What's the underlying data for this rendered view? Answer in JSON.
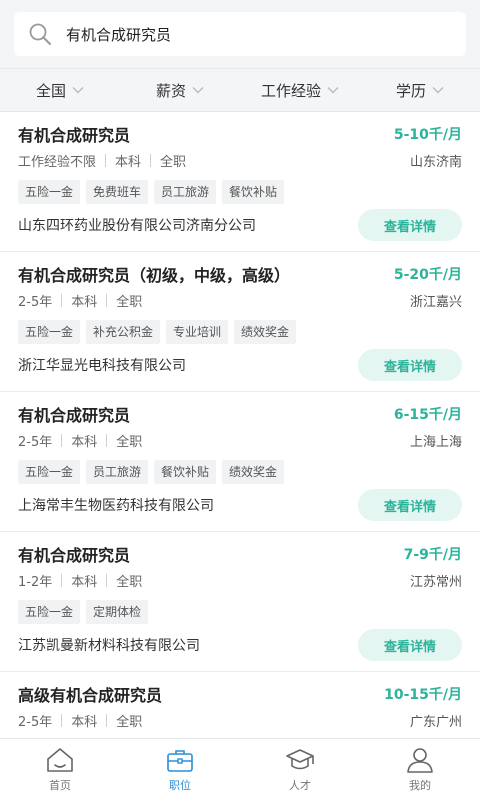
{
  "search": {
    "value": "有机合成研究员"
  },
  "filters": [
    {
      "label": "全国"
    },
    {
      "label": "薪资"
    },
    {
      "label": "工作经验"
    },
    {
      "label": "学历"
    }
  ],
  "jobs": [
    {
      "title": "有机合成研究员",
      "salary": "5-10千/月",
      "experience": "工作经验不限",
      "education": "本科",
      "type": "全职",
      "location": "山东济南",
      "tags": [
        "五险一金",
        "免费班车",
        "员工旅游",
        "餐饮补贴"
      ],
      "company": "山东四环药业股份有限公司济南分公司",
      "button": "查看详情"
    },
    {
      "title": "有机合成研究员（初级，中级，高级）",
      "salary": "5-20千/月",
      "experience": "2-5年",
      "education": "本科",
      "type": "全职",
      "location": "浙江嘉兴",
      "tags": [
        "五险一金",
        "补充公积金",
        "专业培训",
        "绩效奖金"
      ],
      "company": "浙江华显光电科技有限公司",
      "button": "查看详情"
    },
    {
      "title": "有机合成研究员",
      "salary": "6-15千/月",
      "experience": "2-5年",
      "education": "本科",
      "type": "全职",
      "location": "上海上海",
      "tags": [
        "五险一金",
        "员工旅游",
        "餐饮补贴",
        "绩效奖金"
      ],
      "company": "上海常丰生物医药科技有限公司",
      "button": "查看详情"
    },
    {
      "title": "有机合成研究员",
      "salary": "7-9千/月",
      "experience": "1-2年",
      "education": "本科",
      "type": "全职",
      "location": "江苏常州",
      "tags": [
        "五险一金",
        "定期体检"
      ],
      "company": "江苏凯曼新材料科技有限公司",
      "button": "查看详情"
    },
    {
      "title": "高级有机合成研究员",
      "salary": "10-15千/月",
      "experience": "2-5年",
      "education": "本科",
      "type": "全职",
      "location": "广东广州",
      "tags": [],
      "company": "",
      "button": ""
    }
  ],
  "nav": [
    {
      "label": "首页",
      "icon": "home-icon"
    },
    {
      "label": "职位",
      "icon": "briefcase-icon",
      "active": true
    },
    {
      "label": "人才",
      "icon": "graduation-cap-icon"
    },
    {
      "label": "我的",
      "icon": "user-icon"
    }
  ],
  "colors": {
    "accent": "#2bb49a",
    "nav_active": "#2a8fd7"
  }
}
